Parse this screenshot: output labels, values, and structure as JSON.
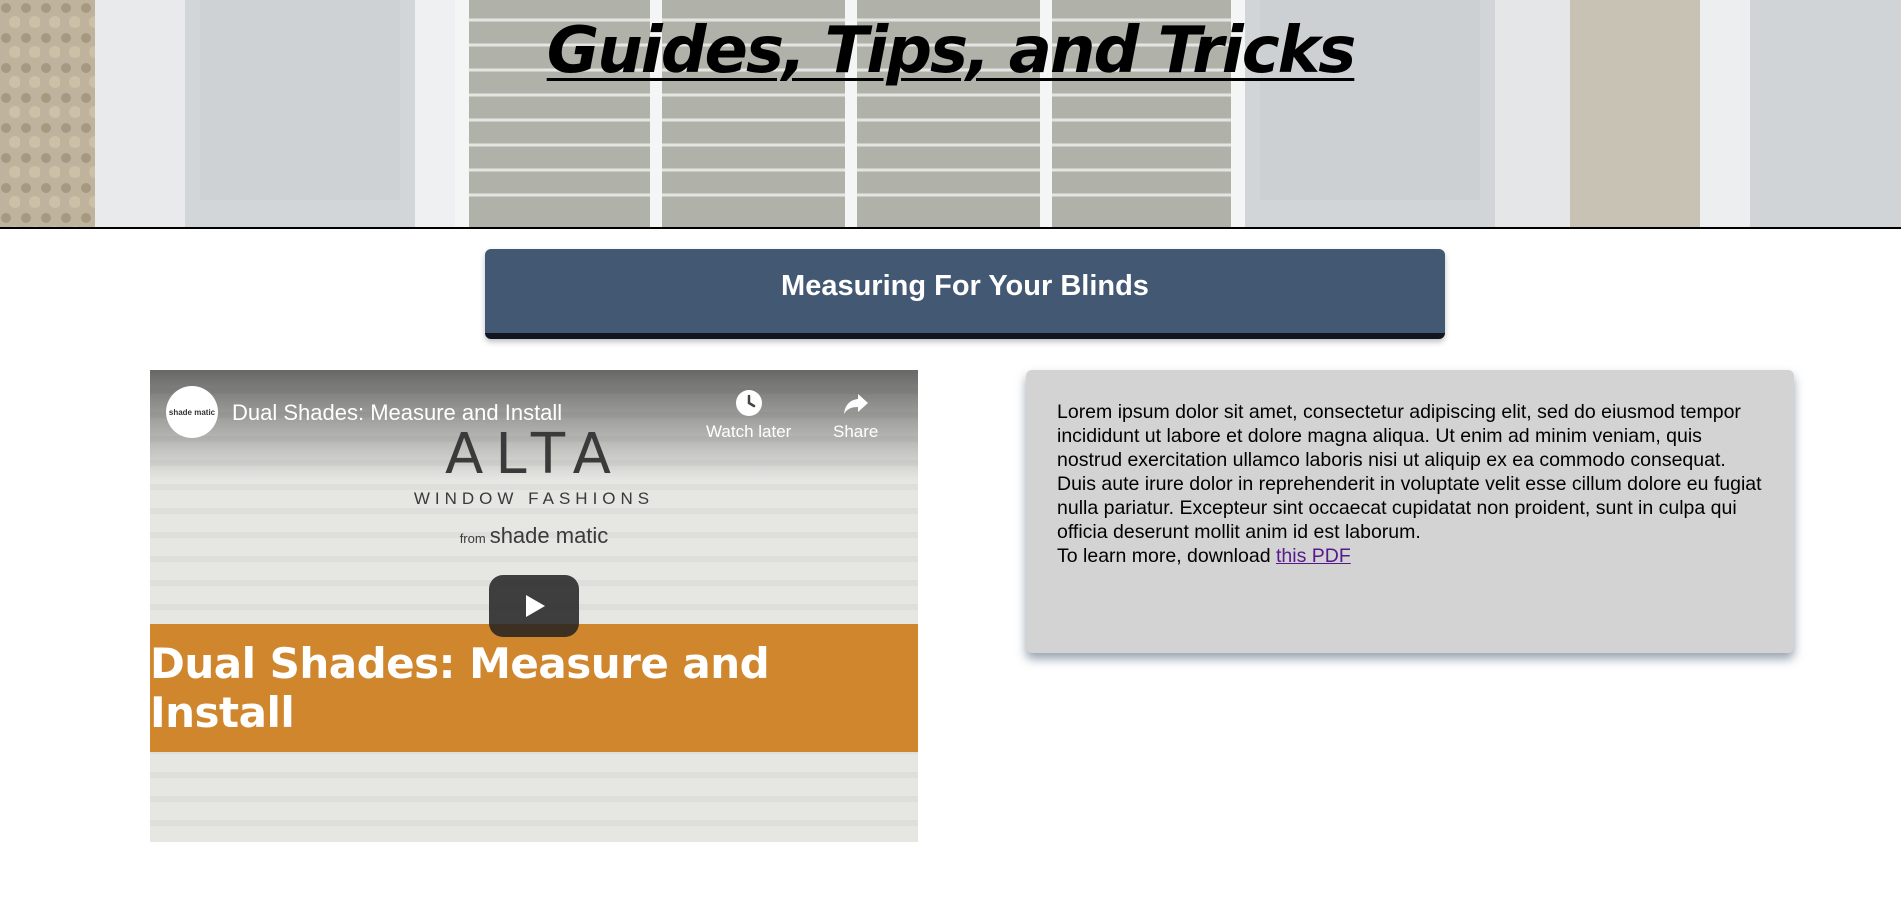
{
  "hero": {
    "title": "Guides, Tips, and Tricks"
  },
  "section": {
    "header_label": "Measuring For Your Blinds"
  },
  "video": {
    "channel_name": "shade matic",
    "title": "Dual Shades: Measure and Install",
    "watch_later_label": "Watch later",
    "share_label": "Share",
    "brand_main": "ALTA",
    "brand_sub": "WINDOW FASHIONS",
    "brand_from": "from",
    "brand_maker": "shade matic",
    "banner_text": "Dual Shades: Measure and Install",
    "banner_color": "#d0862d"
  },
  "card": {
    "body": "Lorem ipsum dolor sit amet, consectetur adipiscing elit, sed do eiusmod tempor incididunt ut labore et dolore magna aliqua. Ut enim ad minim veniam, quis nostrud exercitation ullamco laboris nisi ut aliquip ex ea commodo consequat. Duis aute irure dolor in reprehenderit in voluptate velit esse cillum dolore eu fugiat nulla pariatur. Excepteur sint occaecat cupidatat non proident, sunt in culpa qui officia deserunt mollit anim id est laborum.",
    "learn_more_prefix": "To learn more, download",
    "link_text": "this PDF"
  },
  "colors": {
    "header_bg": "#435872",
    "card_bg": "#d3d3d3",
    "link": "#551a8b"
  }
}
